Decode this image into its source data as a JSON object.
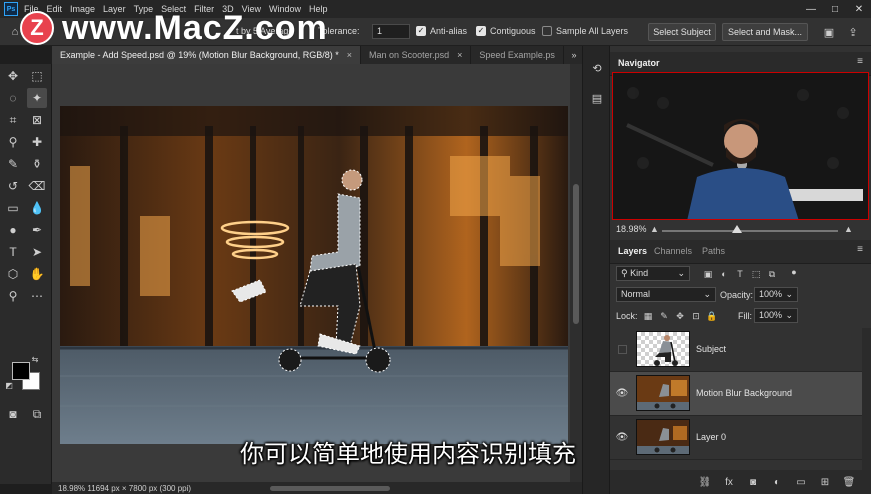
{
  "menubar": {
    "logo": "Ps",
    "items": [
      "File",
      "Edit",
      "Image",
      "Layer",
      "Type",
      "Select",
      "Filter",
      "3D",
      "View",
      "Window",
      "Help"
    ],
    "window_controls": [
      "—",
      "□",
      "✕"
    ]
  },
  "watermark": {
    "badge": "Z",
    "text": "www.MacZ.com"
  },
  "options_bar": {
    "sample_size_partial": "t by 5 Average",
    "tolerance_label": "Tolerance:",
    "tolerance_value": "1",
    "anti_alias_label": "Anti-alias",
    "anti_alias_checked": true,
    "contiguous_label": "Contiguous",
    "contiguous_checked": true,
    "sample_all_layers_label": "Sample All Layers",
    "sample_all_layers_checked": false,
    "select_subject_label": "Select Subject",
    "select_and_mask_label": "Select and Mask..."
  },
  "document_tabs": [
    {
      "label": "Example - Add Speed.psd @ 19% (Motion Blur Background, RGB/8) *",
      "active": true,
      "close": "×"
    },
    {
      "label": "Man on Scooter.psd",
      "active": false,
      "close": "×"
    },
    {
      "label": "Speed Example.ps",
      "active": false,
      "close": ""
    }
  ],
  "tabs_more": "»",
  "status_bar": {
    "text": "18.98%  11694 px × 7800 px (300 ppi)"
  },
  "subtitle": "你可以简单地使用内容识别填充",
  "navigator": {
    "title": "Navigator",
    "zoom_value": "18.98%"
  },
  "layers_panel": {
    "tabs": [
      "Layers",
      "Channels",
      "Paths"
    ],
    "filter_value": "Kind",
    "blend_mode": "Normal",
    "opacity_label": "Opacity:",
    "opacity_value": "100%",
    "lock_label": "Lock:",
    "fill_label": "Fill:",
    "fill_value": "100%",
    "layers": [
      {
        "name": "Subject",
        "visible": false,
        "selected": false
      },
      {
        "name": "Motion Blur Background",
        "visible": true,
        "selected": true
      },
      {
        "name": "Layer 0",
        "visible": true,
        "selected": false
      }
    ],
    "bottom_icons": [
      "link-icon",
      "fx-icon",
      "mask-icon",
      "adjustment-icon",
      "folder-icon",
      "new-layer-icon",
      "trash-icon"
    ]
  },
  "colors": {
    "accent": "#2fa3f7",
    "watermark_badge": "#e8424e",
    "selected_layer": "#4b4b4b"
  }
}
